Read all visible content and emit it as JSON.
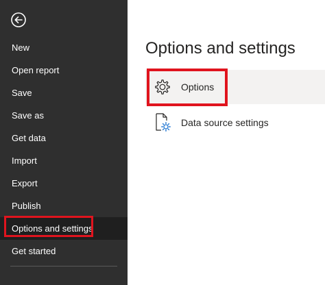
{
  "sidebar": {
    "back_icon": "back-arrow-icon",
    "items": [
      {
        "label": "New"
      },
      {
        "label": "Open report"
      },
      {
        "label": "Save"
      },
      {
        "label": "Save as"
      },
      {
        "label": "Get data"
      },
      {
        "label": "Import"
      },
      {
        "label": "Export"
      },
      {
        "label": "Publish"
      },
      {
        "label": "Options and settings",
        "active": true
      },
      {
        "label": "Get started"
      }
    ]
  },
  "main": {
    "title": "Options and settings",
    "options": [
      {
        "label": "Options",
        "icon": "gear-icon",
        "selected": true
      },
      {
        "label": "Data source settings",
        "icon": "data-source-settings-icon"
      }
    ]
  },
  "colors": {
    "sidebar_bg": "#2f2f2f",
    "active_item_bg": "#1f1f1f",
    "highlight_border": "#e0141e",
    "selected_option_bg": "#f3f2f1",
    "icon_accent": "#2b7cd3"
  }
}
